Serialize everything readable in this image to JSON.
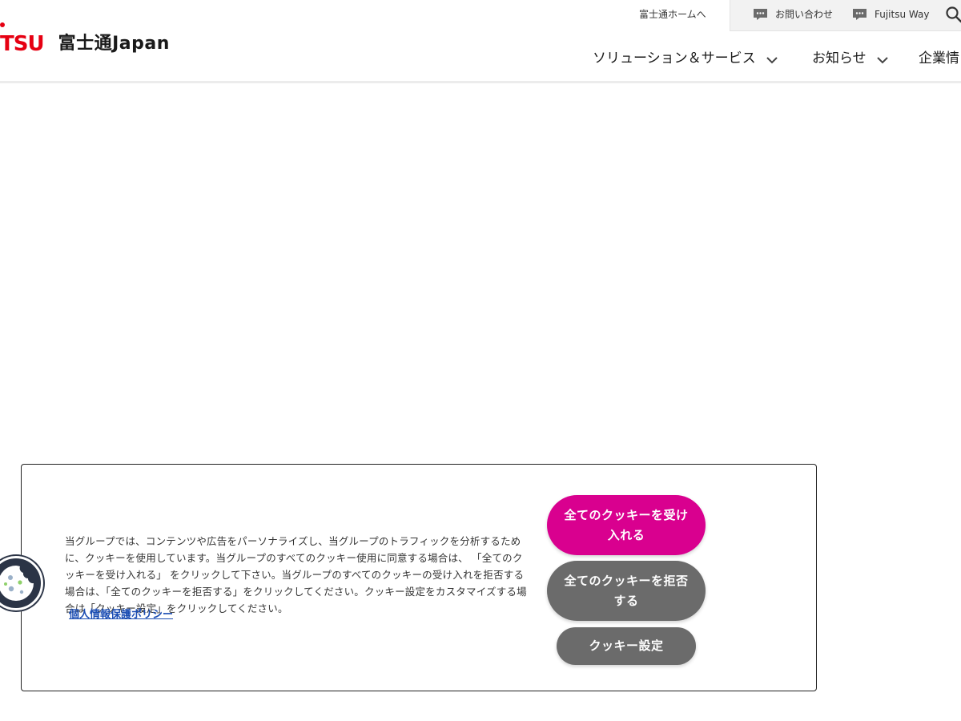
{
  "header": {
    "logo_mark": "TSU",
    "logo_name": "富士通Japan",
    "util_home": "富士通ホームへ",
    "util_contact": "お問い合わせ",
    "util_way": "Fujitsu Way",
    "nav": {
      "solutions": "ソリューション＆サービス",
      "news": "お知らせ",
      "corporate": "企業情"
    }
  },
  "cookie_banner": {
    "text": "当グループでは、コンテンツや広告をパーソナライズし、当グループのトラフィックを分析するために、クッキーを使用しています。当グループのすべてのクッキー使用に同意する場合は、 「全てのクッキーを受け入れる」 をクリックして下さい。当グループのすべてのクッキーの受け入れを拒否する場合は、「全てのクッキーを拒否する」をクリックしてください。クッキー設定をカスタマイズする場合は「クッキー設定」をクリックしてください。",
    "privacy_link": "個人情報保護ポリシー",
    "accept_button": "全てのクッキーを受け入れる",
    "reject_button": "全てのクッキーを拒否する",
    "settings_button": "クッキー設定"
  },
  "colors": {
    "brand_red": "#e60012",
    "accept_pink": "#d9008f",
    "button_gray": "#6b6b6b",
    "link_blue": "#1b4db3"
  },
  "icons": {
    "contact": "chat-bubble-icon",
    "way": "chat-bubble-icon",
    "search": "search-icon",
    "nav_chevron": "chevron-down-icon",
    "cookie_fab": "cookie-icon"
  }
}
